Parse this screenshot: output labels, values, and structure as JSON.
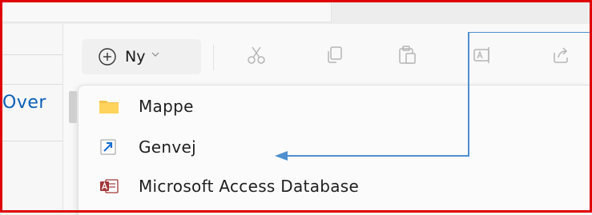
{
  "toolbar": {
    "new_label": "Ny",
    "icons": [
      "cut-icon",
      "copy-icon",
      "paste-icon",
      "rename-icon",
      "share-icon"
    ]
  },
  "sidebar": {
    "partial_text": "Over"
  },
  "new_menu": {
    "items": [
      {
        "label": "Mappe",
        "icon": "folder-icon"
      },
      {
        "label": "Genvej",
        "icon": "shortcut-icon"
      },
      {
        "label": "Microsoft Access Database",
        "icon": "access-database-icon"
      }
    ]
  },
  "colors": {
    "highlight_frame": "#e00000",
    "annotation_arrow": "#4f8fcf",
    "link_text": "#0a5fb8",
    "folder": "#f4c44c",
    "access": "#a4373a"
  }
}
